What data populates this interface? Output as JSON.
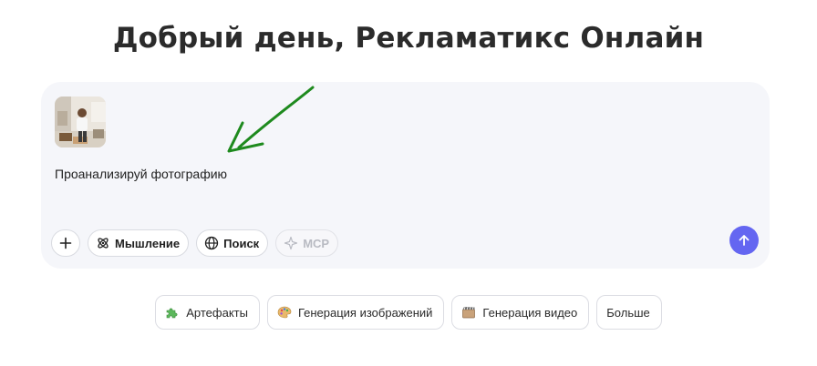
{
  "greeting": "Добрый день, Рекламатикс Онлайн",
  "composer": {
    "prompt_text": "Проанализируй фотографию",
    "attachment_icon": "photo-thumbnail",
    "toolbar": {
      "add_icon": "plus-icon",
      "thinking_label": "Мышление",
      "search_label": "Поиск",
      "mcp_label": "MCP"
    },
    "send_icon": "arrow-up-icon",
    "accent_color": "#6466f1"
  },
  "suggestions": [
    {
      "label": "Артефакты",
      "icon": "puzzle-icon"
    },
    {
      "label": "Генерация изображений",
      "icon": "palette-icon"
    },
    {
      "label": "Генерация видео",
      "icon": "film-box-icon"
    },
    {
      "label": "Больше",
      "icon": ""
    }
  ]
}
